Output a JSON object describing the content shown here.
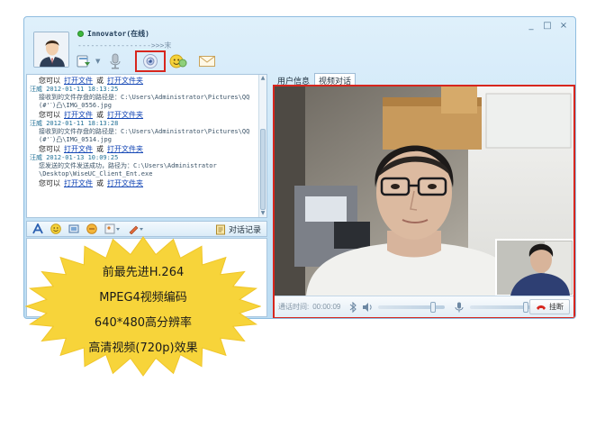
{
  "window": {
    "controls": [
      "_",
      "□",
      "×"
    ],
    "user_name": "Innovator(在线)",
    "signature": "----------------->>>末"
  },
  "toolbar": {
    "icons": [
      "file-transfer-icon",
      "microphone-icon",
      "camera-icon",
      "emoticon-icon",
      "mail-icon"
    ],
    "highlighted": "camera-icon"
  },
  "chat": {
    "lines": [
      {
        "kind": "action",
        "prefix": "您可以",
        "link1": "打开文件",
        "mid": "或",
        "link2": "打开文件夹"
      },
      {
        "kind": "sender",
        "text": "汪威  2012-01-11 18:13:25"
      },
      {
        "kind": "path",
        "text": "接收到的文件存盘的路径是：C:\\Users\\Administrator\\Pictures\\QQ"
      },
      {
        "kind": "path",
        "text": "(#'ˊ)凸\\IMG_0556.jpg"
      },
      {
        "kind": "action",
        "prefix": "您可以",
        "link1": "打开文件",
        "mid": "或",
        "link2": "打开文件夹"
      },
      {
        "kind": "sender",
        "text": "汪威  2012-01-11 18:13:28"
      },
      {
        "kind": "path",
        "text": "接收到的文件存盘的路径是：C:\\Users\\Administrator\\Pictures\\QQ"
      },
      {
        "kind": "path",
        "text": "(#'ˊ)凸\\IMG_0514.jpg"
      },
      {
        "kind": "action",
        "prefix": "您可以",
        "link1": "打开文件",
        "mid": "或",
        "link2": "打开文件夹"
      },
      {
        "kind": "sender",
        "text": "汪威  2012-01-13 10:09:25"
      },
      {
        "kind": "path",
        "text": "您发送的文件发送成功，路径为：C:\\Users\\Administrator"
      },
      {
        "kind": "path",
        "text": "\\Desktop\\WiseUC_Client_Ent.exe"
      },
      {
        "kind": "action",
        "prefix": "您可以",
        "link1": "打开文件",
        "mid": "或",
        "link2": "打开文件夹"
      }
    ]
  },
  "format_bar": {
    "history_label": "对话记录"
  },
  "tabs": [
    {
      "label": "用户信息",
      "active": false
    },
    {
      "label": "视频对话",
      "active": true
    }
  ],
  "video": {
    "time_label": "通话时间:",
    "time_value": "00:00:09",
    "hangup_label": "挂断",
    "volume_level": 0.85,
    "mic_level": 0.9
  },
  "promo": {
    "lines": [
      "前最先进H.264",
      "MPEG4视频编码",
      "640*480高分辨率",
      "高清视频(720p)效果"
    ],
    "fill_color": "#f7d43a",
    "stroke_color": "#f0c62a"
  },
  "colors": {
    "highlight": "#d7261e",
    "link": "#1346b5"
  }
}
